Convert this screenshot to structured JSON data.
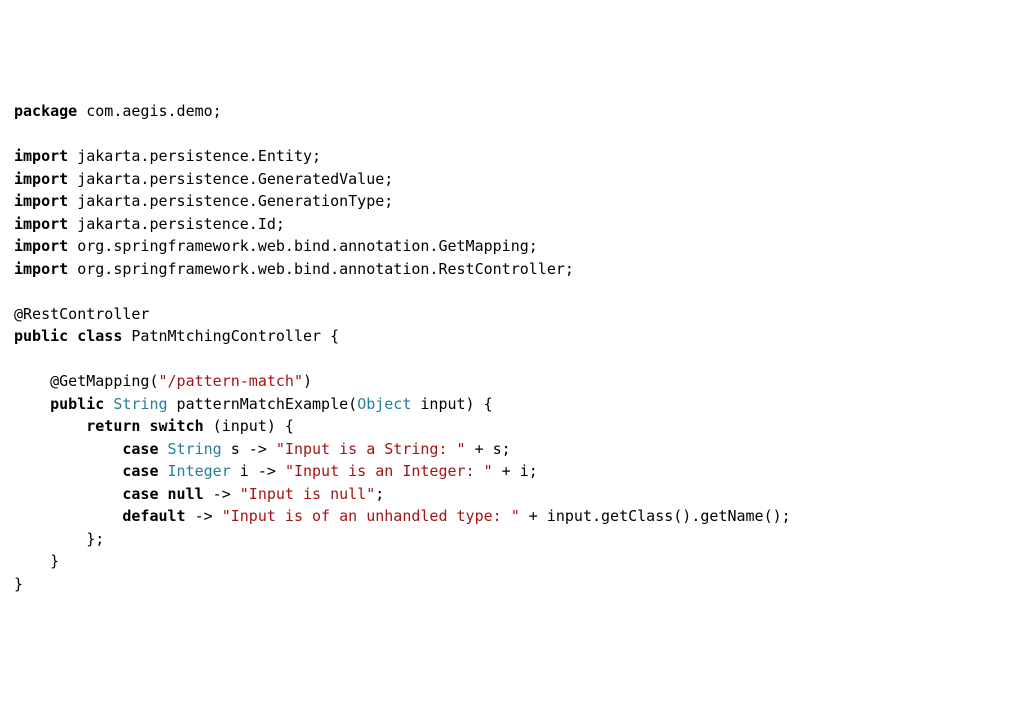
{
  "pkg": {
    "kw": "package",
    "name": " com.aegis.demo;"
  },
  "imports": [
    {
      "kw": "import",
      "name": " jakarta.persistence.Entity;"
    },
    {
      "kw": "import",
      "name": " jakarta.persistence.GeneratedValue;"
    },
    {
      "kw": "import",
      "name": " jakarta.persistence.GenerationType;"
    },
    {
      "kw": "import",
      "name": " jakarta.persistence.Id;"
    },
    {
      "kw": "import",
      "name": " org.springframework.web.bind.annotation.GetMapping;"
    },
    {
      "kw": "import",
      "name": " org.springframework.web.bind.annotation.RestController;"
    }
  ],
  "annotation_rest": "@RestController",
  "classdecl": {
    "kw1": "public",
    "kw2": "class",
    "name": " PatnMtchingController {"
  },
  "mapping": {
    "pre": "    @GetMapping(",
    "str": "\"/pattern-match\"",
    "post": ")"
  },
  "method_sig": {
    "indent": "    ",
    "kw": "public",
    "ret": " String",
    "name": " patternMatchExample(",
    "param_type": "Object",
    "rest": " input) {"
  },
  "switch": {
    "indent": "        ",
    "kw_return": "return",
    "kw_switch": " switch",
    "rest": " (input) {"
  },
  "case1": {
    "indent": "            ",
    "kw": "case",
    "type": " String",
    "var": " s -> ",
    "str": "\"Input is a String: \"",
    "rest": " + s;"
  },
  "case2": {
    "indent": "            ",
    "kw": "case",
    "type": " Integer",
    "var": " i -> ",
    "str": "\"Input is an Integer: \"",
    "rest": " + i;"
  },
  "case3": {
    "indent": "            ",
    "kw1": "case",
    "kw2": " null",
    "arrow": " -> ",
    "str": "\"Input is null\"",
    "rest": ";"
  },
  "default": {
    "indent": "            ",
    "kw": "default",
    "arrow": " -> ",
    "str": "\"Input is of an unhandled type: \"",
    "rest": " + input.getClass().getName();"
  },
  "close_switch": "        };",
  "close_method": "    }",
  "close_class": "}"
}
